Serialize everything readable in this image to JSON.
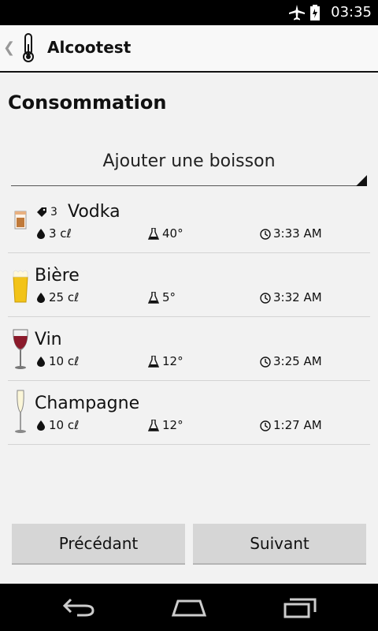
{
  "status_bar": {
    "time": "03:35"
  },
  "action_bar": {
    "title": "Alcootest"
  },
  "heading": "Consommation",
  "spinner": {
    "selected": "Ajouter une boisson"
  },
  "drinks": [
    {
      "name": "Vodka",
      "count": "3",
      "quantity": "3 cℓ",
      "degree": "40°",
      "time": "3:33 AM",
      "icon": "shot-glass-icon"
    },
    {
      "name": "Bière",
      "count": "",
      "quantity": "25 cℓ",
      "degree": "5°",
      "time": "3:32 AM",
      "icon": "beer-glass-icon"
    },
    {
      "name": "Vin",
      "count": "",
      "quantity": "10 cℓ",
      "degree": "12°",
      "time": "3:25 AM",
      "icon": "wine-glass-icon"
    },
    {
      "name": "Champagne",
      "count": "",
      "quantity": "10 cℓ",
      "degree": "12°",
      "time": "1:27 AM",
      "icon": "champagne-flute-icon"
    }
  ],
  "buttons": {
    "previous": "Précédant",
    "next": "Suivant"
  },
  "colors": {
    "wine": "#8b1a2b",
    "beer": "#f2c318",
    "accent": "#000000"
  }
}
